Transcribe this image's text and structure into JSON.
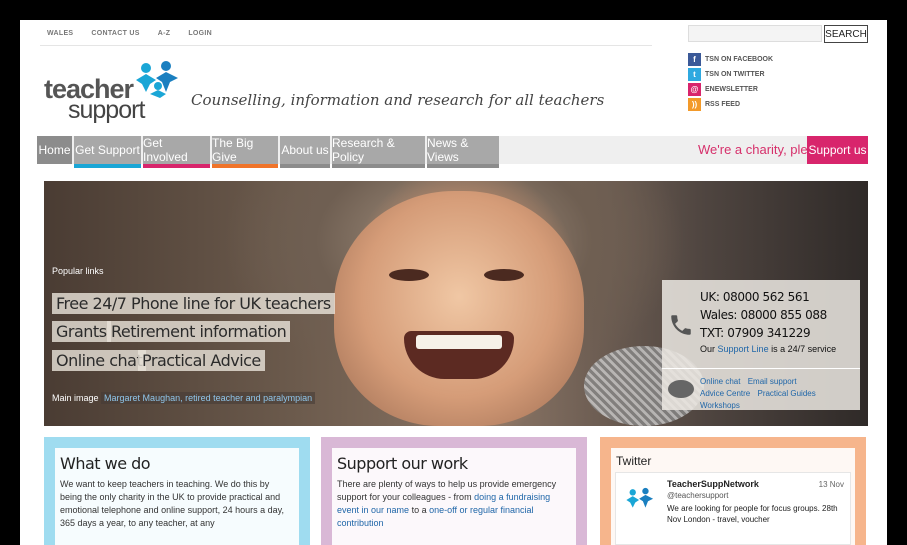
{
  "top_links": [
    "WALES",
    "CONTACT US",
    "A-Z",
    "LOGIN"
  ],
  "search": {
    "button_label": "SEARCH",
    "placeholder": ""
  },
  "social": [
    {
      "label": "TSN ON FACEBOOK",
      "icon": "facebook-icon",
      "color": "#3b5998",
      "glyph": "f"
    },
    {
      "label": "TSN ON TWITTER",
      "icon": "twitter-icon",
      "color": "#2fa9e0",
      "glyph": "t"
    },
    {
      "label": "ENEWSLETTER",
      "icon": "email-icon",
      "color": "#d8256c",
      "glyph": "@"
    },
    {
      "label": "RSS FEED",
      "icon": "rss-icon",
      "color": "#f39a2a",
      "glyph": "))"
    }
  ],
  "logo": {
    "word1": "teacher",
    "word2": "support"
  },
  "tagline": "Counselling, information and research for all teachers",
  "nav": [
    {
      "label": "Home",
      "bg": "#8c8c8c",
      "accent": "#8c8c8c"
    },
    {
      "label": "Get Support",
      "bg": "#a8a8a8",
      "accent": "#1aa6d6"
    },
    {
      "label": "Get Involved",
      "bg": "#a8a8a8",
      "accent": "#d8256c"
    },
    {
      "label": "The Big Give",
      "bg": "#a8a8a8",
      "accent": "#f0742a"
    },
    {
      "label": "About us",
      "bg": "#a8a8a8",
      "accent": "#8c8c8c"
    },
    {
      "label": "Research & Policy",
      "bg": "#a8a8a8",
      "accent": "#8c8c8c"
    },
    {
      "label": "News & Views",
      "bg": "#a8a8a8",
      "accent": "#8c8c8c"
    }
  ],
  "charity_text": "We're a charity, please",
  "support_button": "Support us",
  "hero": {
    "popular_label": "Popular links",
    "links": [
      "Free 24/7 Phone line for UK teachers",
      "Grants",
      "Retirement  information",
      "Online chat",
      "Practical Advice"
    ],
    "caption_prefix": "Main image",
    "caption_credit": "Margaret Maughan, retired teacher and paralympian"
  },
  "contact": {
    "uk": "UK: 08000 562 561",
    "wales": "Wales: 08000 855 088",
    "txt": "TXT: 07909 341229",
    "service_prefix": "Our",
    "service_link": "Support Line",
    "service_suffix": "is a 24/7 service",
    "links_row1": [
      "Online chat",
      "Email support"
    ],
    "links_row2": [
      "Advice Centre",
      "Practical Guides",
      "Workshops"
    ]
  },
  "panels": {
    "what_we_do": {
      "title": "What we do",
      "text": "We want to keep teachers in teaching. We do this by being the only charity in the UK to provide practical and emotional telephone and online support, 24 hours a day, 365 days a year, to any teacher, at any",
      "color": "#9fdcf0"
    },
    "support_our_work": {
      "title": "Support our work",
      "text_a": "There are plenty of ways to help us provide emergency support for your colleagues - from",
      "link_a": "doing a fundraising event in our name",
      "text_b": "to a",
      "link_b": "one-off or regular financial contribution",
      "color": "#d9b8d6"
    },
    "twitter": {
      "title": "Twitter",
      "name": "TeacherSuppNetwork",
      "handle": "@teachersupport",
      "date": "13 Nov",
      "text": "We are looking for people for focus groups. 28th Nov London - travel, voucher",
      "color": "#f6b58c"
    }
  }
}
